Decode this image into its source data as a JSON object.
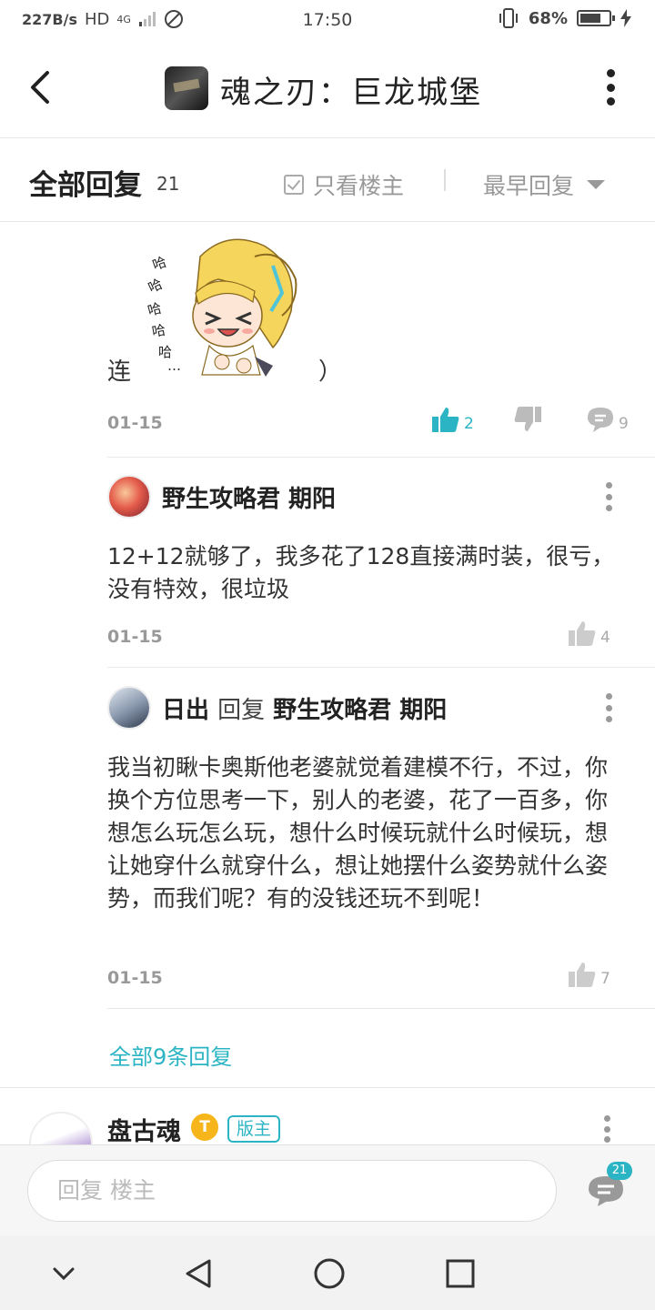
{
  "status_bar": {
    "speed": "227B/s",
    "hd": "HD",
    "network": "4G",
    "time": "17:50",
    "battery": "68%"
  },
  "header": {
    "title": "魂之刃：巨龙城堡"
  },
  "filter_bar": {
    "title": "全部回复",
    "count": "21",
    "only_op": "只看楼主",
    "sort": "最早回复"
  },
  "post": {
    "text_before": "连",
    "text_after": "）",
    "sticker_text": "哈哈哈哈哈…",
    "date": "01-15",
    "likes": "2",
    "comments": "9"
  },
  "replies": [
    {
      "author": "野生攻略君 期阳",
      "reply_word": "",
      "reply_to": "",
      "content": "12+12就够了，我多花了128直接满时装，很亏，没有特效，很垃圾",
      "date": "01-15",
      "likes": "4"
    },
    {
      "author": "日出",
      "reply_word": "回复",
      "reply_to": "野生攻略君 期阳",
      "content": "我当初瞅卡奥斯他老婆就觉着建模不行，不过，你换个方位思考一下，别人的老婆，花了一百多，你想怎么玩怎么玩，想什么时候玩就什么时候玩，想让她穿什么就穿什么，想让她摆什么姿势就什么姿势，而我们呢？有的没钱还玩不到呢！",
      "date": "01-15",
      "likes": "7"
    }
  ],
  "all_replies_link": "全部9条回复",
  "next_post": {
    "author": "盘古魂",
    "badge_t": "T",
    "badge_mod": "版主"
  },
  "input_bar": {
    "placeholder": "回复  楼主",
    "comment_count": "21"
  },
  "colors": {
    "accent": "#2bb4c3",
    "badge_gold": "#f5b51b"
  }
}
